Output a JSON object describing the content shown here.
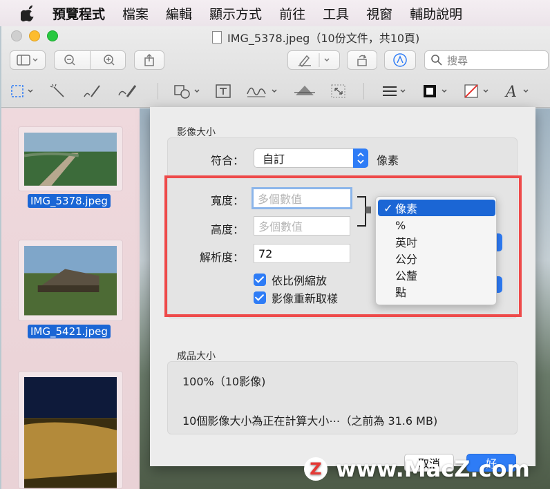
{
  "menubar": {
    "items": [
      {
        "label": "預覽程式",
        "bold": true
      },
      {
        "label": "檔案"
      },
      {
        "label": "編輯"
      },
      {
        "label": "顯示方式"
      },
      {
        "label": "前往"
      },
      {
        "label": "工具"
      },
      {
        "label": "視窗"
      },
      {
        "label": "輔助說明"
      }
    ]
  },
  "window": {
    "title": "IMG_5378.jpeg（10份文件，共10頁)",
    "search_placeholder": "搜尋"
  },
  "sidebar": {
    "items": [
      {
        "label": "IMG_5378.jpeg"
      },
      {
        "label": "IMG_5421.jpeg"
      }
    ]
  },
  "sheet": {
    "image_size_title": "影像大小",
    "fit_label": "符合：",
    "fit_value": "自訂",
    "fit_unit": "像素",
    "width_label": "寬度：",
    "width_placeholder": "多個數值",
    "height_label": "高度：",
    "height_placeholder": "多個數值",
    "resolution_label": "解析度：",
    "resolution_value": "72",
    "scale_proportionally": "依比例縮放",
    "resample_image": "影像重新取樣",
    "result_title": "成品大小",
    "result_percent": "100%（10影像)",
    "result_size": "10個影像大小為正在計算大小⋯（之前為 31.6 MB)",
    "cancel_label": "取消",
    "ok_label": "好"
  },
  "unit_menu": {
    "selected": "像素",
    "items": [
      "像素",
      "%",
      "英吋",
      "公分",
      "公釐",
      "點"
    ]
  },
  "watermark": {
    "logo": "Z",
    "text": "www.MacZ.com"
  },
  "colors": {
    "accent": "#2e7cf6",
    "highlight": "#1b66d5",
    "annotation_red": "#ee4a4a"
  }
}
